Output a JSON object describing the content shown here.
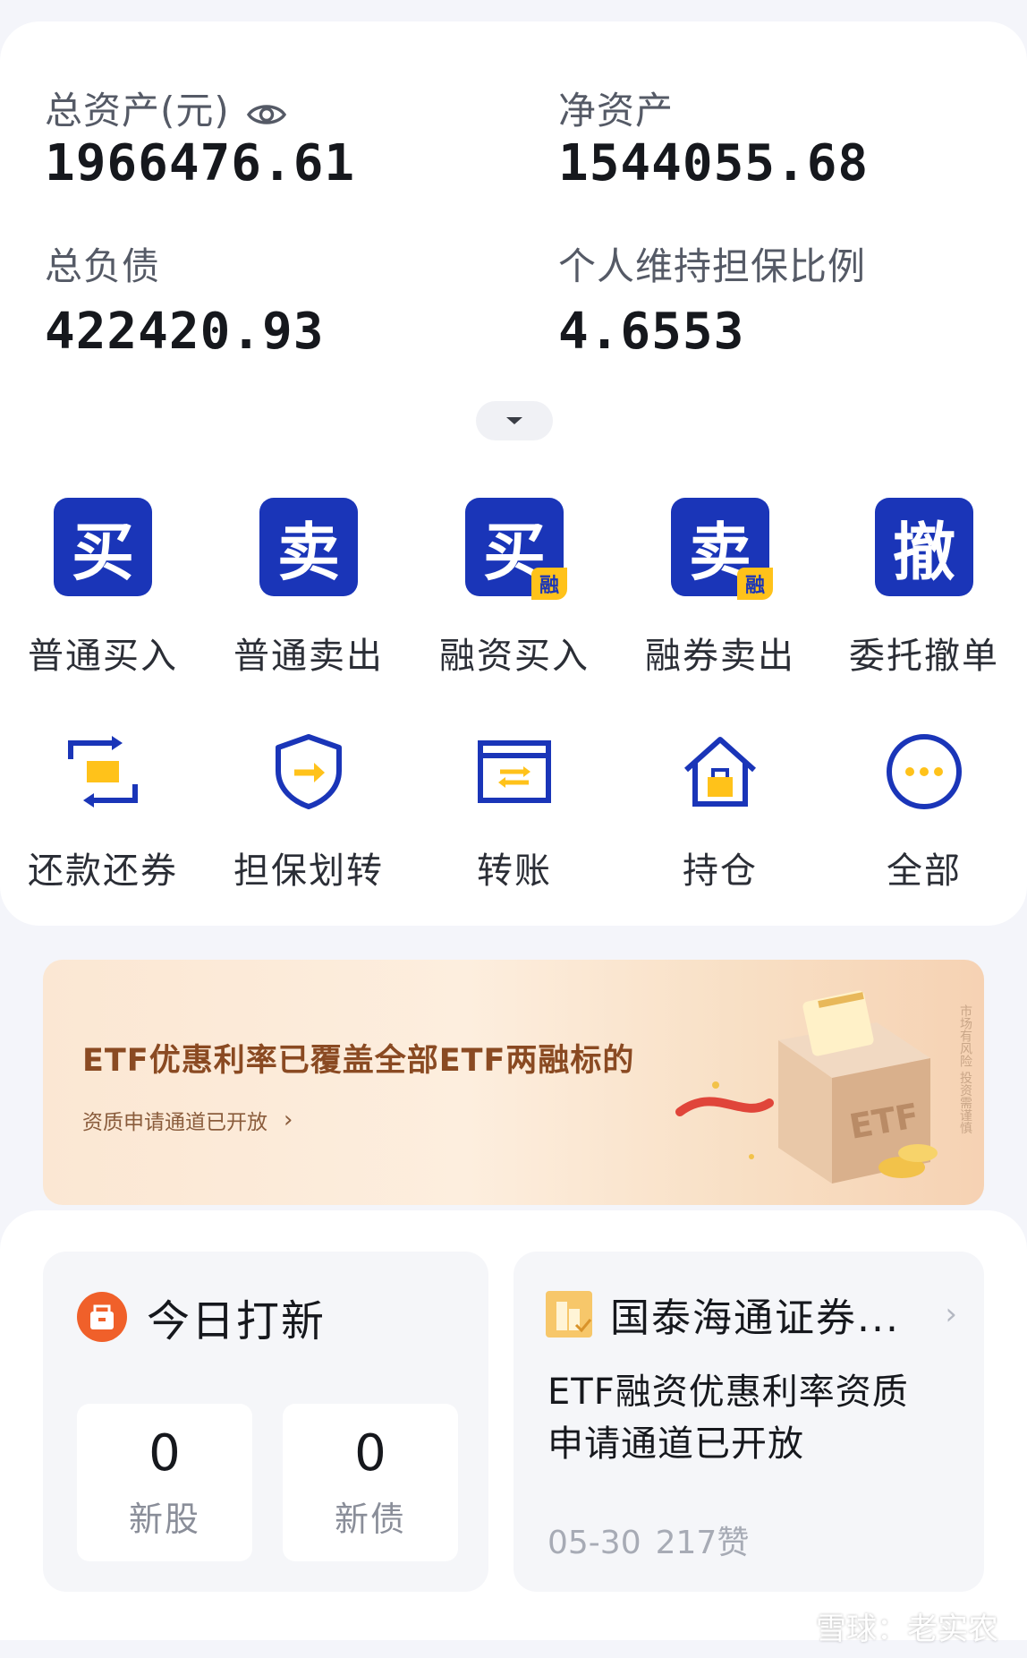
{
  "assets": {
    "total_assets_label": "总资产(元)",
    "total_assets_value": "1966476.61",
    "net_assets_label": "净资产",
    "net_assets_value": "1544055.68",
    "total_liabilities_label": "总负债",
    "total_liabilities_value": "422420.93",
    "maintenance_ratio_label": "个人维持担保比例",
    "maintenance_ratio_value": "4.6553"
  },
  "actions_row1": [
    {
      "glyph": "买",
      "label": "普通买入",
      "badge": ""
    },
    {
      "glyph": "卖",
      "label": "普通卖出",
      "badge": ""
    },
    {
      "glyph": "买",
      "label": "融资买入",
      "badge": "融"
    },
    {
      "glyph": "卖",
      "label": "融券卖出",
      "badge": "融"
    },
    {
      "glyph": "撤",
      "label": "委托撤单",
      "badge": ""
    }
  ],
  "actions_row2": [
    {
      "icon": "repay-icon",
      "label": "还款还券"
    },
    {
      "icon": "collateral-transfer-icon",
      "label": "担保划转"
    },
    {
      "icon": "transfer-icon",
      "label": "转账"
    },
    {
      "icon": "holdings-icon",
      "label": "持仓"
    },
    {
      "icon": "more-icon",
      "label": "全部"
    }
  ],
  "banner": {
    "title": "ETF优惠利率已覆盖全部ETF两融标的",
    "subtitle": "资质申请通道已开放",
    "art_text": "ETF",
    "side_note": "市场有风险 投资需谨慎"
  },
  "ipo": {
    "title": "今日打新",
    "new_stocks_count": "0",
    "new_stocks_label": "新股",
    "new_bonds_count": "0",
    "new_bonds_label": "新债"
  },
  "news": {
    "source": "国泰海通证券...",
    "body": "ETF融资优惠利率资质申请通道已开放",
    "date": "05-30",
    "likes": "217赞"
  },
  "watermark": "雪球：老实农",
  "colors": {
    "brand_blue": "#1a35b8",
    "badge_yellow": "#ffc21a",
    "ipo_orange": "#f0602a",
    "page_bg": "#f4f5fa"
  }
}
